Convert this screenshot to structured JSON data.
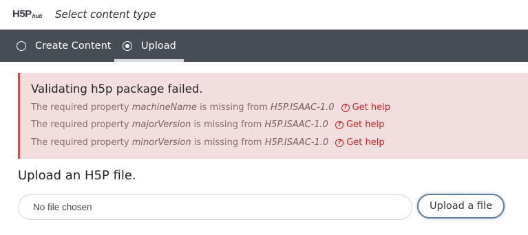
{
  "header": {
    "logo_main": "H5P",
    "logo_sub": "hub",
    "title": "Select content type"
  },
  "tabs": [
    {
      "label": "Create Content",
      "selected": false
    },
    {
      "label": "Upload",
      "selected": true
    }
  ],
  "error": {
    "title": "Validating h5p package failed.",
    "prefix": "The required property",
    "middle": "is missing from",
    "help_label": "Get help",
    "items": [
      {
        "property": "machineName",
        "library": "H5P.ISAAC-1.0"
      },
      {
        "property": "majorVersion",
        "library": "H5P.ISAAC-1.0"
      },
      {
        "property": "minorVersion",
        "library": "H5P.ISAAC-1.0"
      }
    ]
  },
  "upload": {
    "heading": "Upload an H5P file.",
    "file_placeholder": "No file chosen",
    "button_label": "Upload a file"
  },
  "colors": {
    "tab_bar": "#474d54",
    "error_bg": "#f2dede",
    "error_border": "#da4b4b",
    "help_link": "#c72522",
    "button_border": "#5e7c99"
  }
}
